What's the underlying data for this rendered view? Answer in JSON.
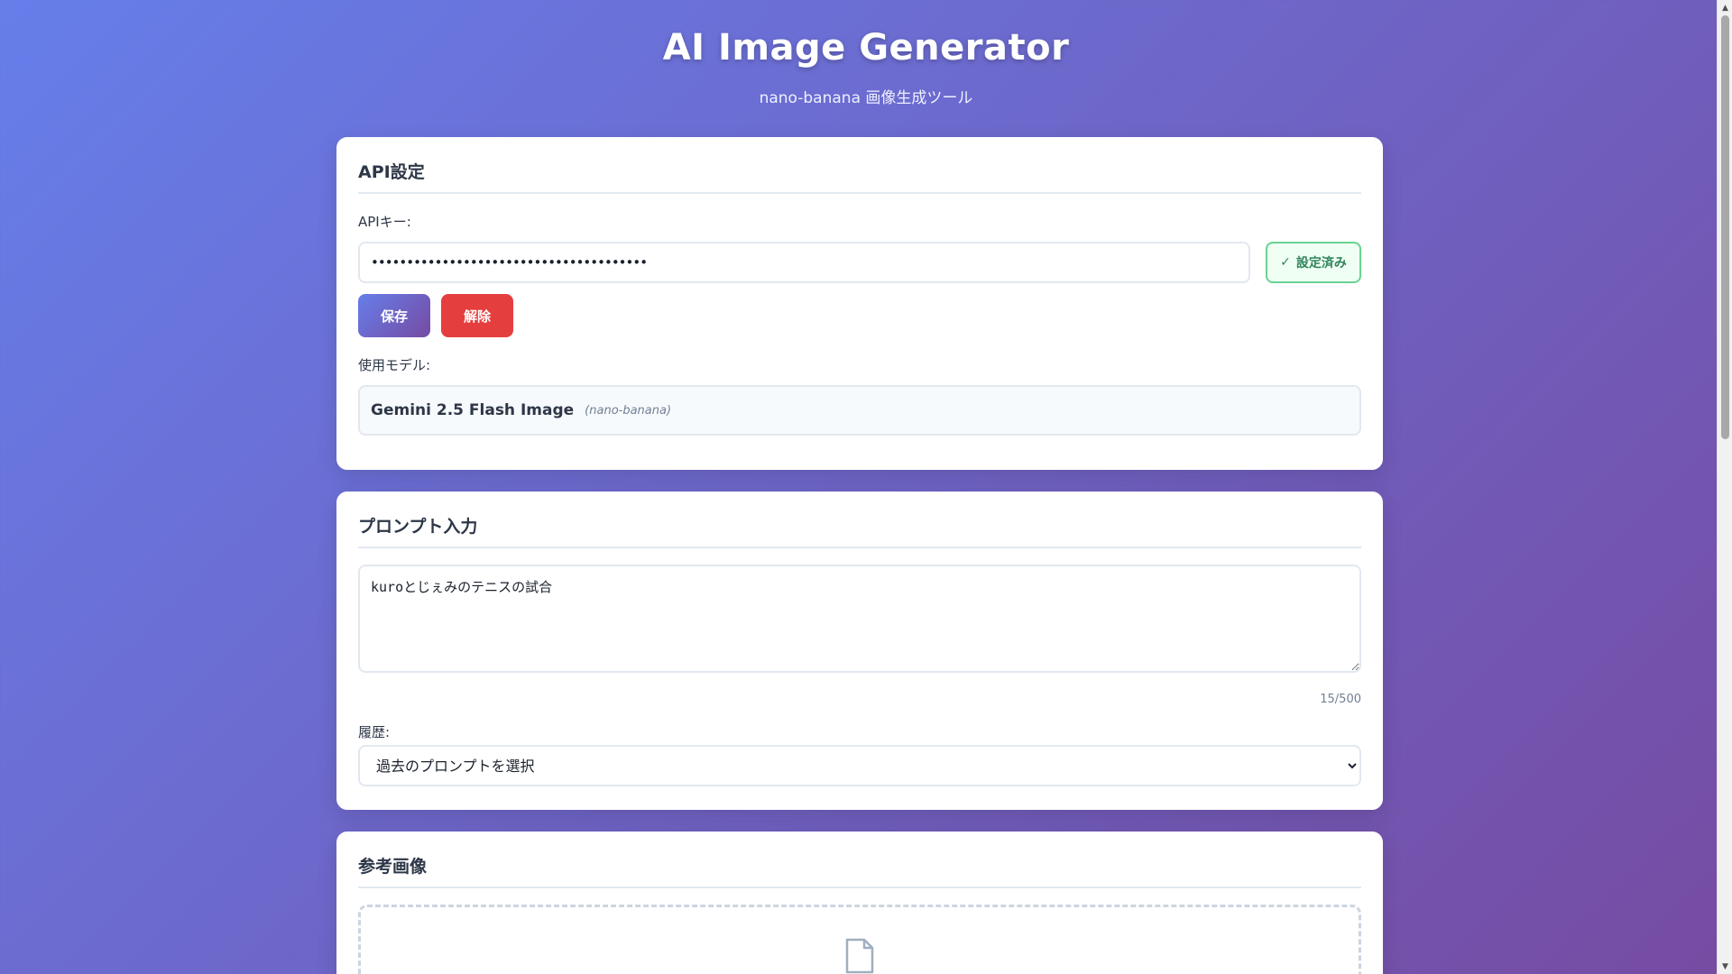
{
  "header": {
    "title": "AI Image Generator",
    "subtitle": "nano-banana 画像生成ツール"
  },
  "api_settings": {
    "heading": "API設定",
    "key_label": "APIキー:",
    "key_value": "•••••••••••••••••••••••••••••••••••••••",
    "status_label": "設定済み",
    "save_label": "保存",
    "clear_label": "解除",
    "model_label": "使用モデル:",
    "model_name": "Gemini 2.5 Flash Image",
    "model_code": "(nano-banana)"
  },
  "prompt": {
    "heading": "プロンプト入力",
    "value": "kuroとじぇみのテニスの試合",
    "char_count": "15/500",
    "history_label": "履歴:",
    "history_selected": "過去のプロンプトを選択"
  },
  "reference": {
    "heading": "参考画像"
  },
  "icons": {
    "status": "check-icon",
    "upload": "file-icon",
    "select": "chevron-down-icon"
  },
  "colors": {
    "accent_start": "#667eea",
    "accent_end": "#764ba2",
    "danger": "#e53e3e",
    "success": "#2f855a"
  }
}
